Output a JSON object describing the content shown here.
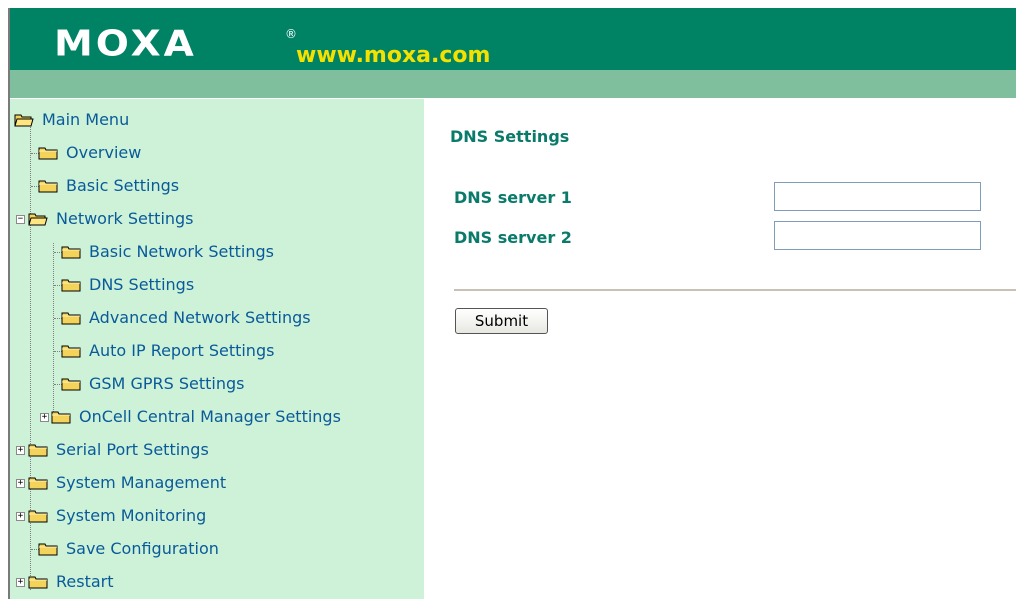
{
  "header": {
    "logo_text": "MOXA",
    "logo_reg": "®",
    "url": "www.moxa.com"
  },
  "colors": {
    "header_green": "#008265",
    "header_band": "#7fbf9e",
    "sidebar_bg": "#cdf2d8",
    "title_green": "#0a7a6a",
    "link_blue": "#0a5a9a",
    "url_yellow": "#f5e100",
    "folder_yellow": "#f4d35a"
  },
  "sidebar": {
    "root": {
      "label": "Main Menu",
      "icon": "open-folder-icon"
    },
    "items": [
      {
        "label": "Overview",
        "icon": "folder-icon",
        "expander": ""
      },
      {
        "label": "Basic Settings",
        "icon": "folder-icon",
        "expander": ""
      },
      {
        "label": "Network Settings",
        "icon": "open-folder-icon",
        "expander": "−"
      },
      {
        "label": "Basic Network Settings",
        "icon": "folder-icon",
        "expander": ""
      },
      {
        "label": "DNS Settings",
        "icon": "folder-icon",
        "expander": ""
      },
      {
        "label": "Advanced Network Settings",
        "icon": "folder-icon",
        "expander": ""
      },
      {
        "label": "Auto IP Report Settings",
        "icon": "folder-icon",
        "expander": ""
      },
      {
        "label": "GSM GPRS Settings",
        "icon": "folder-icon",
        "expander": ""
      },
      {
        "label": "OnCell Central Manager Settings",
        "icon": "folder-icon",
        "expander": "+"
      },
      {
        "label": "Serial Port Settings",
        "icon": "folder-icon",
        "expander": "+"
      },
      {
        "label": "System Management",
        "icon": "folder-icon",
        "expander": "+"
      },
      {
        "label": "System Monitoring",
        "icon": "folder-icon",
        "expander": "+"
      },
      {
        "label": "Save Configuration",
        "icon": "folder-icon",
        "expander": ""
      },
      {
        "label": "Restart",
        "icon": "folder-icon",
        "expander": "+"
      }
    ]
  },
  "main": {
    "title": "DNS Settings",
    "fields": [
      {
        "label": "DNS server 1",
        "value": ""
      },
      {
        "label": "DNS server 2",
        "value": ""
      }
    ],
    "submit_label": "Submit"
  }
}
